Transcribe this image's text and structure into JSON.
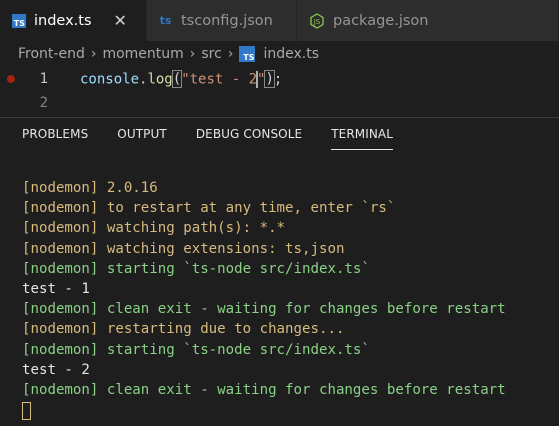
{
  "tabs": [
    {
      "icon": "ts-file-icon",
      "label": "index.ts",
      "active": true,
      "close": "✕"
    },
    {
      "icon": "ts-file-icon",
      "label": "tsconfig.json",
      "active": false
    },
    {
      "icon": "nodejs-file-icon",
      "label": "package.json",
      "active": false
    }
  ],
  "breadcrumb": {
    "items": [
      "Front-end",
      "momentum",
      "src",
      "index.ts"
    ],
    "sep": "›"
  },
  "editor": {
    "lines": [
      {
        "number": "1",
        "tokens": {
          "obj": "console",
          "dot": ".",
          "fn": "log",
          "open": "(",
          "str_a": "\"test - 2",
          "str_b": "\"",
          "close": ")",
          "semi": ";"
        }
      },
      {
        "number": "2"
      }
    ]
  },
  "panel": {
    "tabs": [
      "PROBLEMS",
      "OUTPUT",
      "DEBUG CONSOLE",
      "TERMINAL"
    ],
    "active_tab": "TERMINAL"
  },
  "terminal": {
    "lines": [
      {
        "text": "[nodemon] 2.0.16",
        "color": "#d7ba7d"
      },
      {
        "text": "[nodemon] to restart at any time, enter `rs`",
        "color": "#d7ba7d"
      },
      {
        "text": "[nodemon] watching path(s): *.*",
        "color": "#d7ba7d"
      },
      {
        "text": "[nodemon] watching extensions: ts,json",
        "color": "#d7ba7d"
      },
      {
        "text": "[nodemon] starting `ts-node src/index.ts`",
        "color": "#89d185"
      },
      {
        "text": "test - 1",
        "color": "#e5e5e5"
      },
      {
        "text": "[nodemon] clean exit - waiting for changes before restart",
        "color": "#89d185"
      },
      {
        "text": "[nodemon] restarting due to changes...",
        "color": "#d7ba7d"
      },
      {
        "text": "[nodemon] starting `ts-node src/index.ts`",
        "color": "#89d185"
      },
      {
        "text": "test - 2",
        "color": "#e5e5e5"
      },
      {
        "text": "[nodemon] clean exit - waiting for changes before restart",
        "color": "#89d185"
      }
    ]
  },
  "colors": {
    "ts_blue": "#3178c6",
    "breakpoint": "#a1260d",
    "term_yellow": "#d7ba7d",
    "term_green": "#89d185"
  }
}
